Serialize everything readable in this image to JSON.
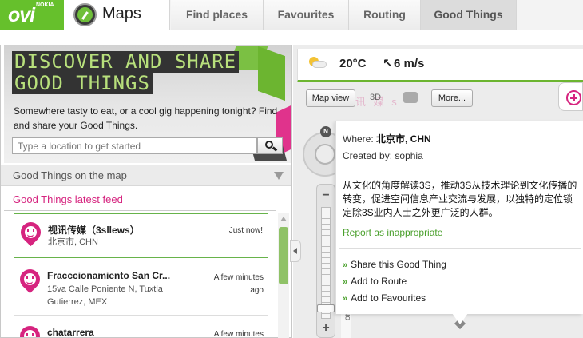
{
  "header": {
    "logo_text": "ovi",
    "logo_sub": "NOKIA",
    "app_title": "Maps",
    "tabs": [
      {
        "label": "Find places"
      },
      {
        "label": "Favourites"
      },
      {
        "label": "Routing"
      },
      {
        "label": "Good Things",
        "active": true
      }
    ]
  },
  "hero": {
    "title_line1": "DISCOVER AND SHARE",
    "title_line2": "GOOD THINGS",
    "subtitle": "Somewhere tasty to eat, or a cool gig happening tonight? Find and share your Good Things.",
    "search_placeholder": "Type a location to get started"
  },
  "map_section": {
    "label": "Good Things on the map"
  },
  "feed": {
    "title": "Good Things latest feed",
    "items": [
      {
        "name": "视讯传媒（3sllews）",
        "address": "北京市, CHN",
        "time": "Just now!"
      },
      {
        "name": "Fracccionamiento San Cr...",
        "address": "15va Calle Poniente N, Tuxtla Gutierrez, MEX",
        "time": "A few minutes ago"
      },
      {
        "name": "chatarrera",
        "address": "",
        "time": "A few minutes"
      }
    ]
  },
  "weather": {
    "temperature": "20°C",
    "wind_arrow": "↖",
    "wind": "6 m/s"
  },
  "map_controls": {
    "map_view_label": "Map view",
    "three_d_label": "3D",
    "more_label": "More...",
    "compass_label": "N",
    "zoom_out": "−",
    "zoom_in": "+",
    "zoom_level": 0.94,
    "ghost_text": "讯 媒 s"
  },
  "bubble": {
    "where_label": "Where:",
    "where_value": "北京市, CHN",
    "created_label": "Created by:",
    "created_value": "sophia",
    "description": "从文化的角度解读3S，推动3S从技术理论到文化传播的转变，促进空间信息产业交流与发展，以独特的定位锁定除3S业内人士之外更广泛的人群。",
    "report_label": "Report as inappropriate",
    "actions": [
      {
        "label": "Share this Good Thing"
      },
      {
        "label": "Add to Route"
      },
      {
        "label": "Add to Favourites"
      }
    ]
  },
  "map": {
    "road_label": "ong"
  },
  "colors": {
    "brand_green": "#66c02c",
    "accent_pink": "#d6247f",
    "link_green": "#4aa02c"
  }
}
